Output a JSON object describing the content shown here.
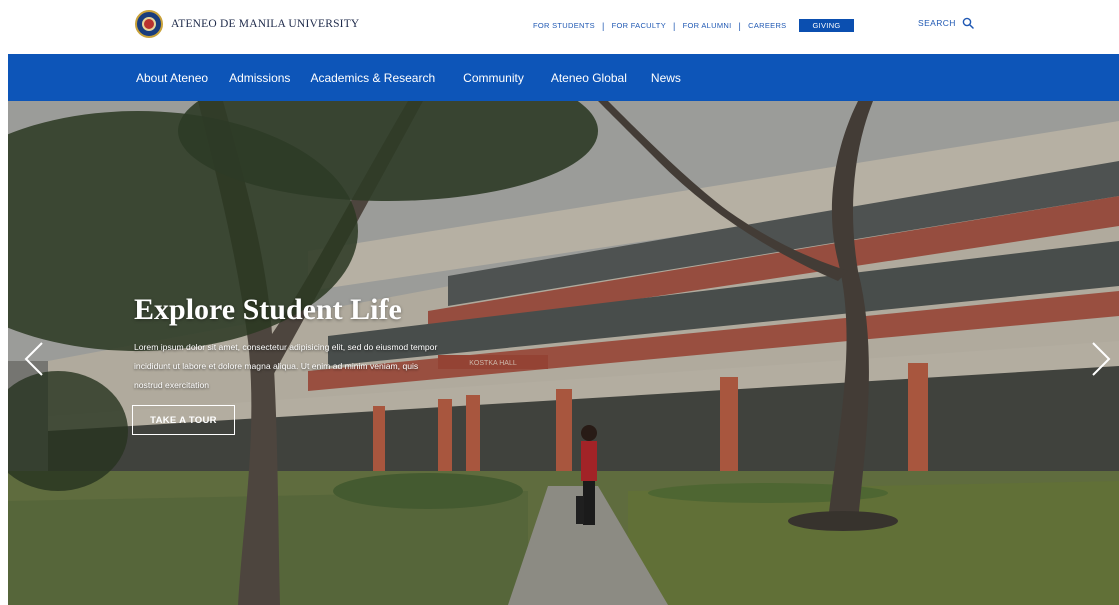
{
  "header": {
    "university_name": "ATENEO DE MANILA UNIVERSITY",
    "links": [
      {
        "label": "FOR STUDENTS"
      },
      {
        "label": "FOR FACULTY"
      },
      {
        "label": "FOR ALUMNI"
      },
      {
        "label": "CAREERS"
      }
    ],
    "giving_label": "GIVING",
    "search_label": "SEARCH"
  },
  "nav": {
    "items": [
      {
        "label": "About Ateneo"
      },
      {
        "label": "Admissions"
      },
      {
        "label": "Academics & Research"
      },
      {
        "label": "Community"
      },
      {
        "label": "Ateneo Global"
      },
      {
        "label": "News"
      }
    ]
  },
  "hero": {
    "title": "Explore Student Life",
    "body": "Lorem ipsum dolor sit amet, consectetur adipisicing elit, sed do eiusmod tempor incididunt ut labore et dolore magna aliqua. Ut enim ad minim veniam, quis nostrud exercitation",
    "cta_label": "TAKE A TOUR",
    "building_sign": "KOSTKA HALL"
  },
  "colors": {
    "brand_blue": "#0d55b8",
    "link_blue": "#1f58b3",
    "white": "#ffffff"
  },
  "icons": {
    "search": "search-icon",
    "prev": "chevron-left-icon",
    "next": "chevron-right-icon",
    "seal": "university-seal-icon"
  }
}
